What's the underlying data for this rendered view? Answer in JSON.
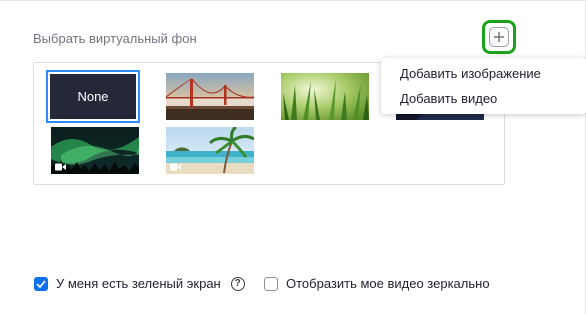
{
  "title": "Выбрать виртуальный фон",
  "add_button": {
    "icon": "plus-icon"
  },
  "backgrounds": [
    {
      "label": "None",
      "selected": true
    },
    {
      "name": "golden-gate-bridge",
      "type": "image"
    },
    {
      "name": "green-grass",
      "type": "image"
    },
    {
      "name": "aurora",
      "type": "video"
    },
    {
      "name": "beach-palm",
      "type": "video"
    }
  ],
  "dropdown": {
    "items": [
      {
        "label": "Добавить изображение"
      },
      {
        "label": "Добавить видео"
      }
    ]
  },
  "options": {
    "green_screen": {
      "label": "У меня есть зеленый экран",
      "checked": true,
      "help": "?"
    },
    "mirror": {
      "label": "Отобразить мое видео зеркально",
      "checked": false
    }
  },
  "colors": {
    "accent": "#0e71eb",
    "highlight_border": "#1aa31a",
    "selected_border": "#2d8cff"
  }
}
